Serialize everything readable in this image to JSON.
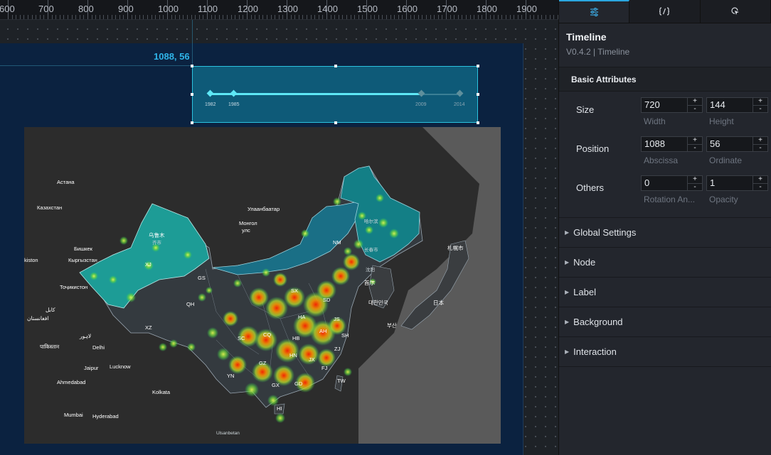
{
  "ruler": {
    "ticks": [
      "600",
      "700",
      "800",
      "900",
      "1000",
      "1100",
      "1200",
      "1300",
      "1400",
      "1500",
      "1600",
      "1700",
      "1800",
      "1900"
    ]
  },
  "canvas": {
    "coord_label": "1088, 56"
  },
  "timeline": {
    "labels": [
      "1982",
      "1985",
      "2009",
      "2014"
    ],
    "colors": {
      "active": "#5ee7f5",
      "inactive": "#3b7f95"
    }
  },
  "map": {
    "labels": [
      "Астана",
      "Казахстан",
      "Улаанбаатар",
      "Монгол",
      "улс",
      "Бишкек",
      "Кыргызстан",
      "kiston",
      "Тоҷикистон",
      "乌鲁木",
      "齐市",
      "XJ",
      "GS",
      "QH",
      "XZ",
      "NM",
      "长春市",
      "哈尔滨",
      "沈阳",
      "SX",
      "HA",
      "SD",
      "AH",
      "JS",
      "SH",
      "HB",
      "CQ",
      "SC",
      "GZ",
      "YN",
      "GX",
      "GD",
      "HN",
      "FJ",
      "ZJ",
      "JX",
      "HI",
      "TW",
      "首尔",
      "대한민국",
      "부산",
      "日本",
      "札幌市",
      "Delhi",
      "Jaipur",
      "Lucknow",
      "Ahmedabad",
      "Kolkata",
      "Mumbai",
      "Hyderabad",
      "पाकिस्तान",
      "لاہور",
      "کابل",
      "افغانستان",
      "Ulsanbetan"
    ]
  },
  "panel": {
    "tabs": [
      {
        "name": "config",
        "icon": "sliders-icon"
      },
      {
        "name": "data",
        "icon": "code-braces-icon"
      },
      {
        "name": "interaction",
        "icon": "interaction-icon"
      }
    ],
    "component_title": "Timeline",
    "component_subtitle": "V0.4.2 | Timeline",
    "basic_attributes": "Basic Attributes",
    "size": {
      "label": "Size",
      "width": "720",
      "width_caption": "Width",
      "height": "144",
      "height_caption": "Height"
    },
    "position": {
      "label": "Position",
      "x": "1088",
      "x_caption": "Abscissa",
      "y": "56",
      "y_caption": "Ordinate"
    },
    "others": {
      "label": "Others",
      "rotation": "0",
      "rotation_caption": "Rotation An...",
      "opacity": "1",
      "opacity_caption": "Opacity"
    },
    "sections": [
      "Global Settings",
      "Node",
      "Label",
      "Background",
      "Interaction"
    ],
    "stepper": {
      "plus": "+",
      "minus": "-"
    }
  }
}
